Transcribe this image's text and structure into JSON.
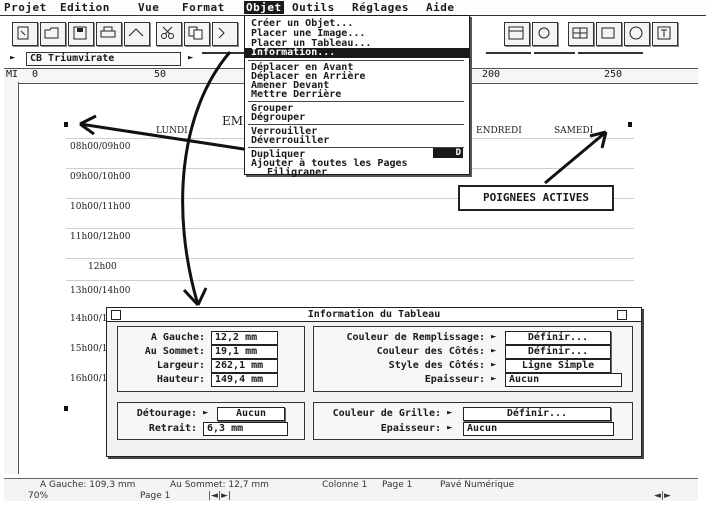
{
  "menubar": {
    "items": [
      "Projet",
      "Edition",
      "Vue",
      "Format",
      "Objet",
      "Outils",
      "Réglages",
      "Aide"
    ]
  },
  "toolbar": {
    "style_field": "CB Triumvirate",
    "icons": [
      "new-document-icon",
      "open-icon",
      "save-icon",
      "print-icon",
      "cut-icon",
      "copy-icon",
      "paste-icon"
    ]
  },
  "ruler": {
    "marks": [
      "0",
      "50",
      "200",
      "250"
    ],
    "left_label": "MI"
  },
  "objet_menu": {
    "items": [
      {
        "label": "Créer un Objet...",
        "highlight": false
      },
      {
        "label": "Placer une Image...",
        "highlight": false
      },
      {
        "label": "Placer un Tableau...",
        "highlight": false
      },
      {
        "label": "Information...",
        "highlight": true
      },
      {
        "label": "Déplacer en Avant",
        "highlight": false
      },
      {
        "label": "Déplacer en Arrière",
        "highlight": false
      },
      {
        "label": "Amener Devant",
        "highlight": false
      },
      {
        "label": "Mettre Derrière",
        "highlight": false
      },
      {
        "label": "Grouper",
        "highlight": false
      },
      {
        "label": "Dégrouper",
        "highlight": false
      },
      {
        "label": "Verrouiller",
        "highlight": false
      },
      {
        "label": "Déverrouiller",
        "highlight": false
      },
      {
        "label": "Dupliquer",
        "highlight": false
      },
      {
        "label": "Ajouter à toutes les Pages",
        "highlight": false
      },
      {
        "label": "Filigraner",
        "highlight": false
      }
    ],
    "shortcut": "D"
  },
  "document": {
    "title_fragment": "EM",
    "days": [
      "LUNDI",
      "ENDREDI",
      "SAMEDI"
    ],
    "times": [
      "08h00/09h00",
      "09h00/10h00",
      "10h00/11h00",
      "11h00/12h00",
      "12h00",
      "13h00/14h00",
      "14h00/1",
      "15h00/1",
      "16h00/1"
    ]
  },
  "callout": {
    "text": "POIGNEES ACTIVES"
  },
  "dialog": {
    "title": "Information du Tableau",
    "position": {
      "left_label": "A Gauche:",
      "left_value": "12,2 mm",
      "top_label": "Au Sommet:",
      "top_value": "19,1 mm",
      "width_label": "Largeur:",
      "width_value": "262,1 mm",
      "height_label": "Hauteur:",
      "height_value": "149,4 mm"
    },
    "colors": {
      "fill_label": "Couleur de Remplissage:",
      "fill_btn": "Définir...",
      "sides_label": "Couleur des Côtés:",
      "sides_btn": "Définir...",
      "style_label": "Style des Côtés:",
      "style_value": "Ligne Simple",
      "thickness_label": "Epaisseur:",
      "thickness_value": "Aucun"
    },
    "wrap": {
      "wrap_label": "Détourage:",
      "wrap_value": "Aucun",
      "indent_label": "Retrait:",
      "indent_value": "6,3 mm"
    },
    "grid": {
      "grid_label": "Couleur de Grille:",
      "grid_btn": "Définir...",
      "thickness_label": "Epaisseur:",
      "thickness_value": "Aucun"
    }
  },
  "status": {
    "left": "A Gauche: 109,3 mm",
    "top": "Au Sommet: 12,7 mm",
    "column": "Colonne 1",
    "page": "Page 1",
    "numeric": "Pavé Numérique",
    "zoom": "70%",
    "page_nav": "Page 1"
  },
  "colors": {
    "ink": "#1a1a1a",
    "paper": "#ffffff",
    "panel": "#f2f2f2"
  }
}
